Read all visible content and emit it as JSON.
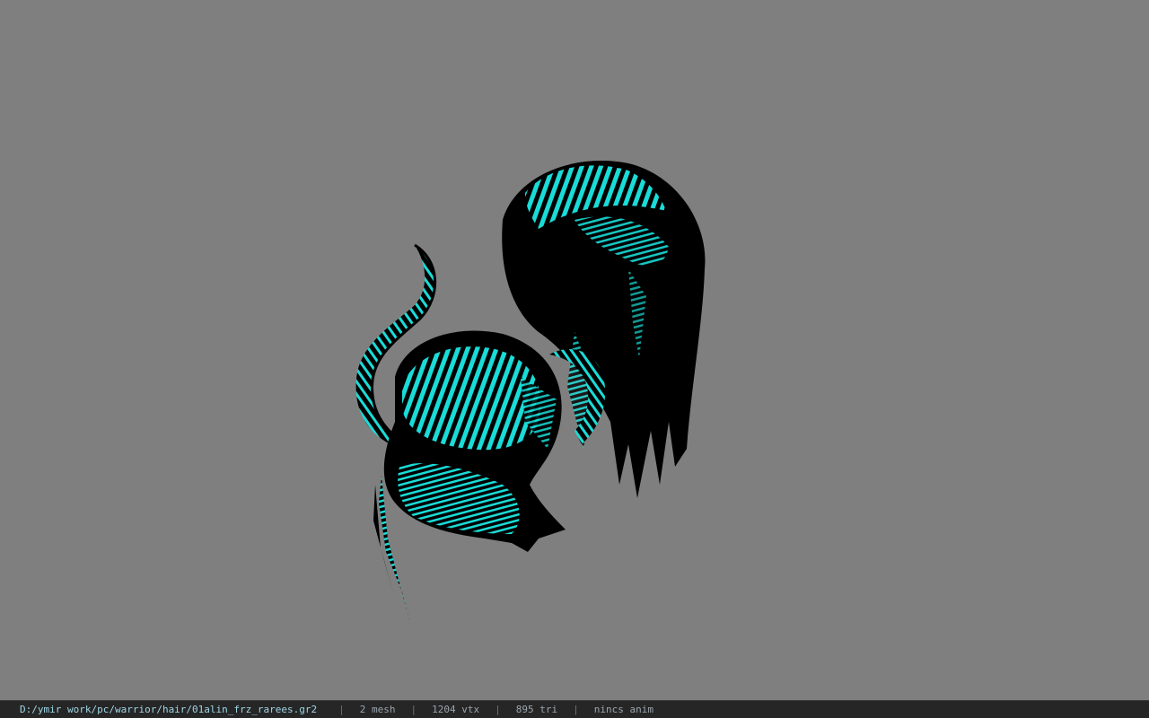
{
  "viewer": {
    "background_color": "#7f7f7f",
    "model": {
      "base_color": "#000000",
      "texture_color": "#19dcd8"
    }
  },
  "status_bar": {
    "file_path": "D:/ymir work/pc/warrior/hair/01alin_frz_rarees.gr2",
    "separator": "|",
    "mesh_count": "2 mesh",
    "vertex_count": "1204 vtx",
    "triangle_count": "895 tri",
    "animation": "nincs anim"
  }
}
